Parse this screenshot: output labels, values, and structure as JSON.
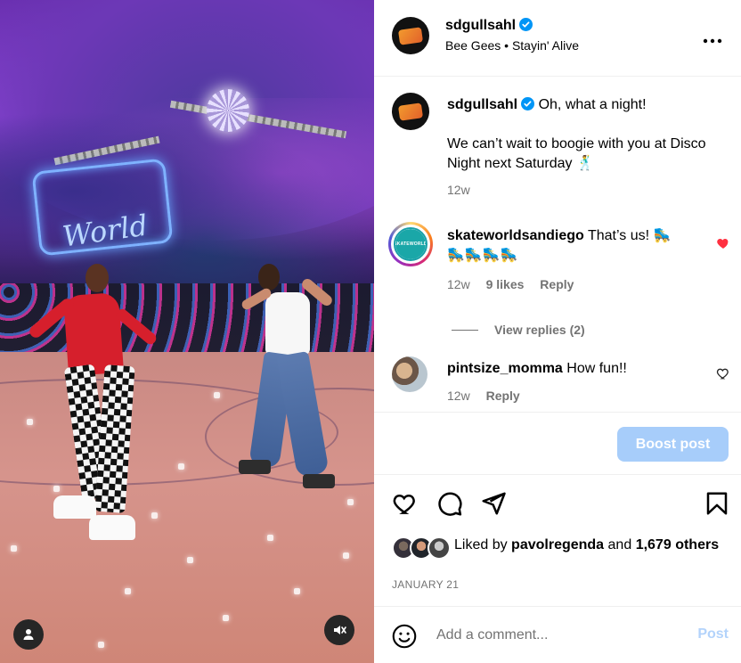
{
  "post": {
    "username": "sdgullsahl",
    "audio": "Bee Gees • Stayin' Alive",
    "more_icon": "more-horizontal-icon"
  },
  "caption": {
    "username": "sdgullsahl",
    "line1": "Oh, what a night!",
    "line2": "We can’t wait to boogie with you at Disco Night next Saturday 🕺",
    "age": "12w"
  },
  "comments": [
    {
      "username": "skateworldsandiego",
      "text": "That’s us! 🛼",
      "text2": "🛼🛼🛼🛼",
      "age": "12w",
      "likes": "9 likes",
      "reply": "Reply",
      "liked": true,
      "view_replies": "View replies (2)",
      "avatar_label": "SKATEWORLD"
    },
    {
      "username": "pintsize_momma",
      "text": "How fun!!",
      "age": "12w",
      "reply": "Reply",
      "liked": false
    }
  ],
  "boost": {
    "label": "Boost post"
  },
  "actions": [
    "heart-icon",
    "comment-icon",
    "share-icon",
    "bookmark-icon"
  ],
  "likes": {
    "liked_by_prefix": "Liked by",
    "liked_by_user": "pavolregenda",
    "and": "and",
    "count": "1,679",
    "others": "others"
  },
  "date": "JANUARY 21",
  "composer": {
    "placeholder": "Add a comment...",
    "post_label": "Post"
  },
  "colors": {
    "verified": "#0095f6",
    "liked_heart": "#ff3040",
    "boost_bg": "#a7cdfa",
    "post_disabled": "#b3d3fb"
  }
}
